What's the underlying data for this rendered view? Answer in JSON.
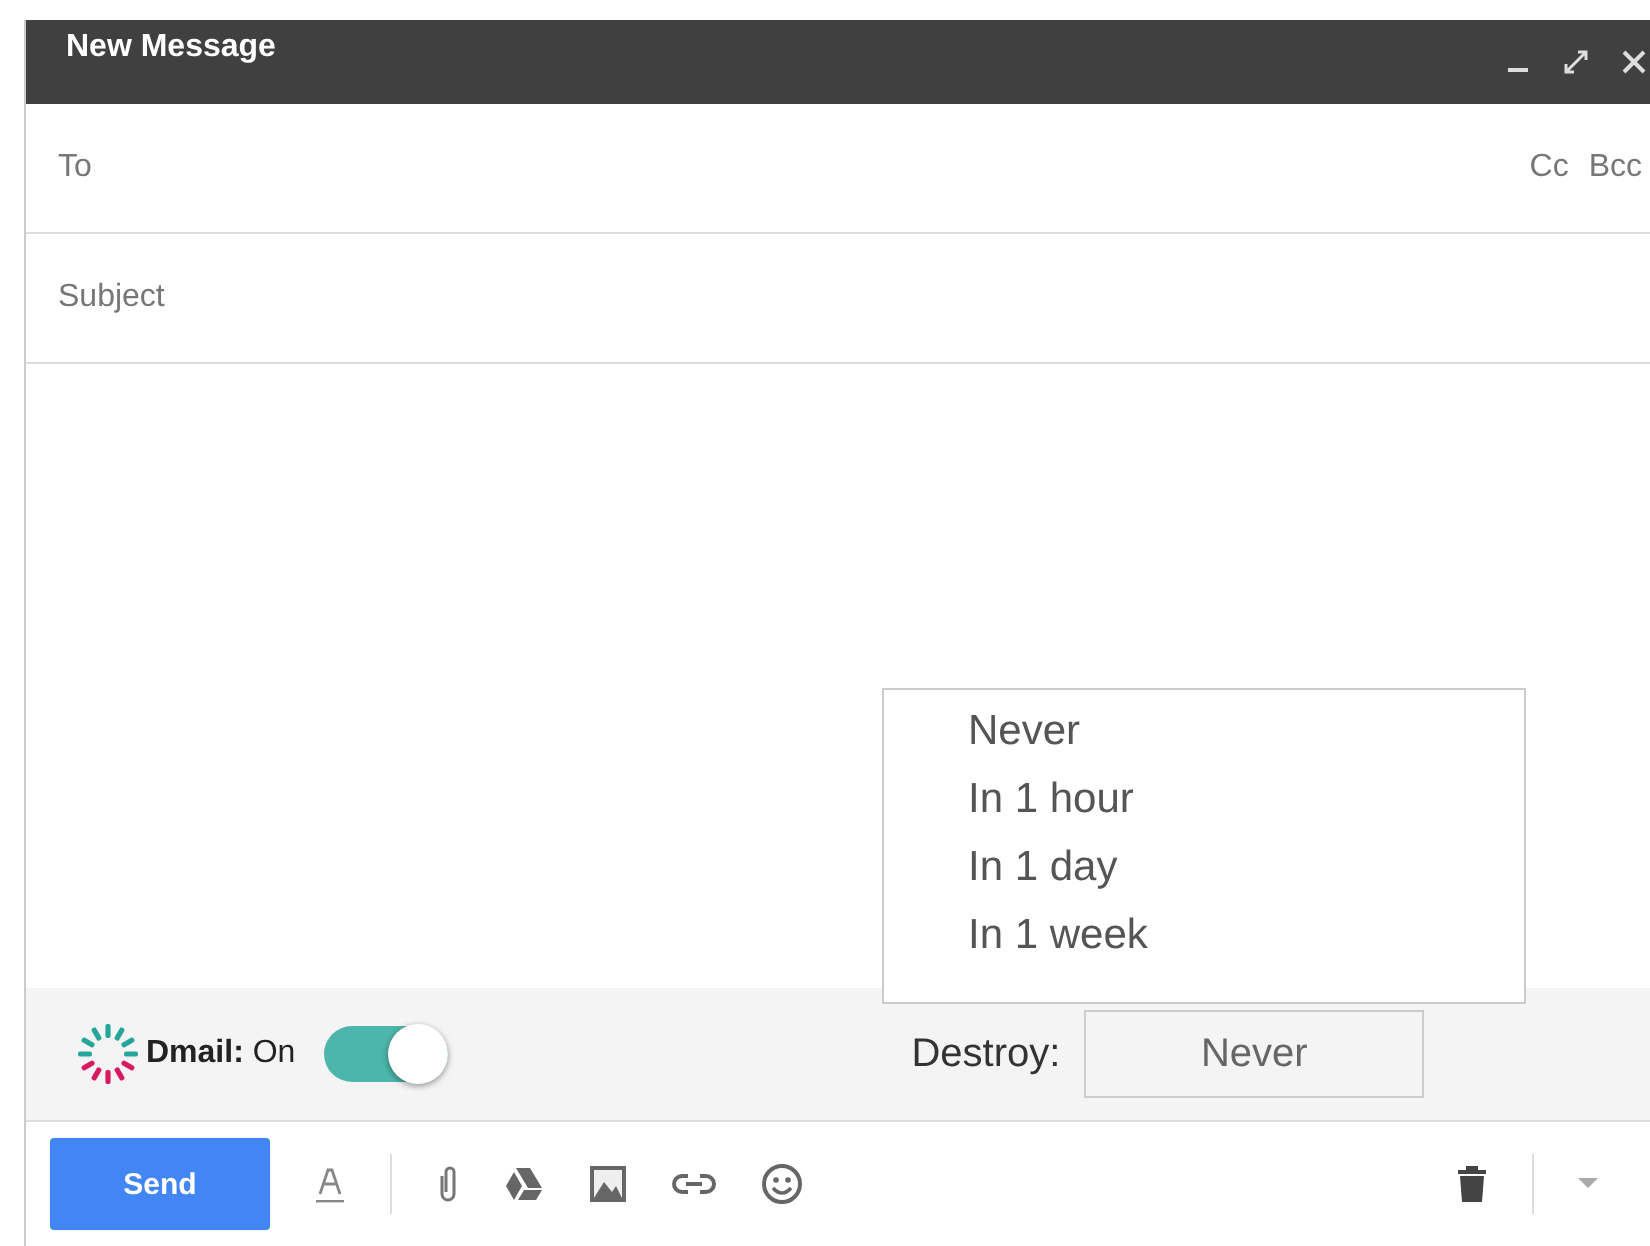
{
  "window": {
    "title": "New Message"
  },
  "to": {
    "placeholder": "To",
    "cc": "Cc",
    "bcc": "Bcc"
  },
  "subject": {
    "placeholder": "Subject"
  },
  "destroy_menu": {
    "options": [
      "Never",
      "In 1 hour",
      "In 1 day",
      "In 1 week"
    ]
  },
  "dmail_bar": {
    "label": "Dmail:",
    "state": "On",
    "on": true,
    "destroy_label": "Destroy:",
    "destroy_value": "Never"
  },
  "toolbar": {
    "send": "Send"
  }
}
